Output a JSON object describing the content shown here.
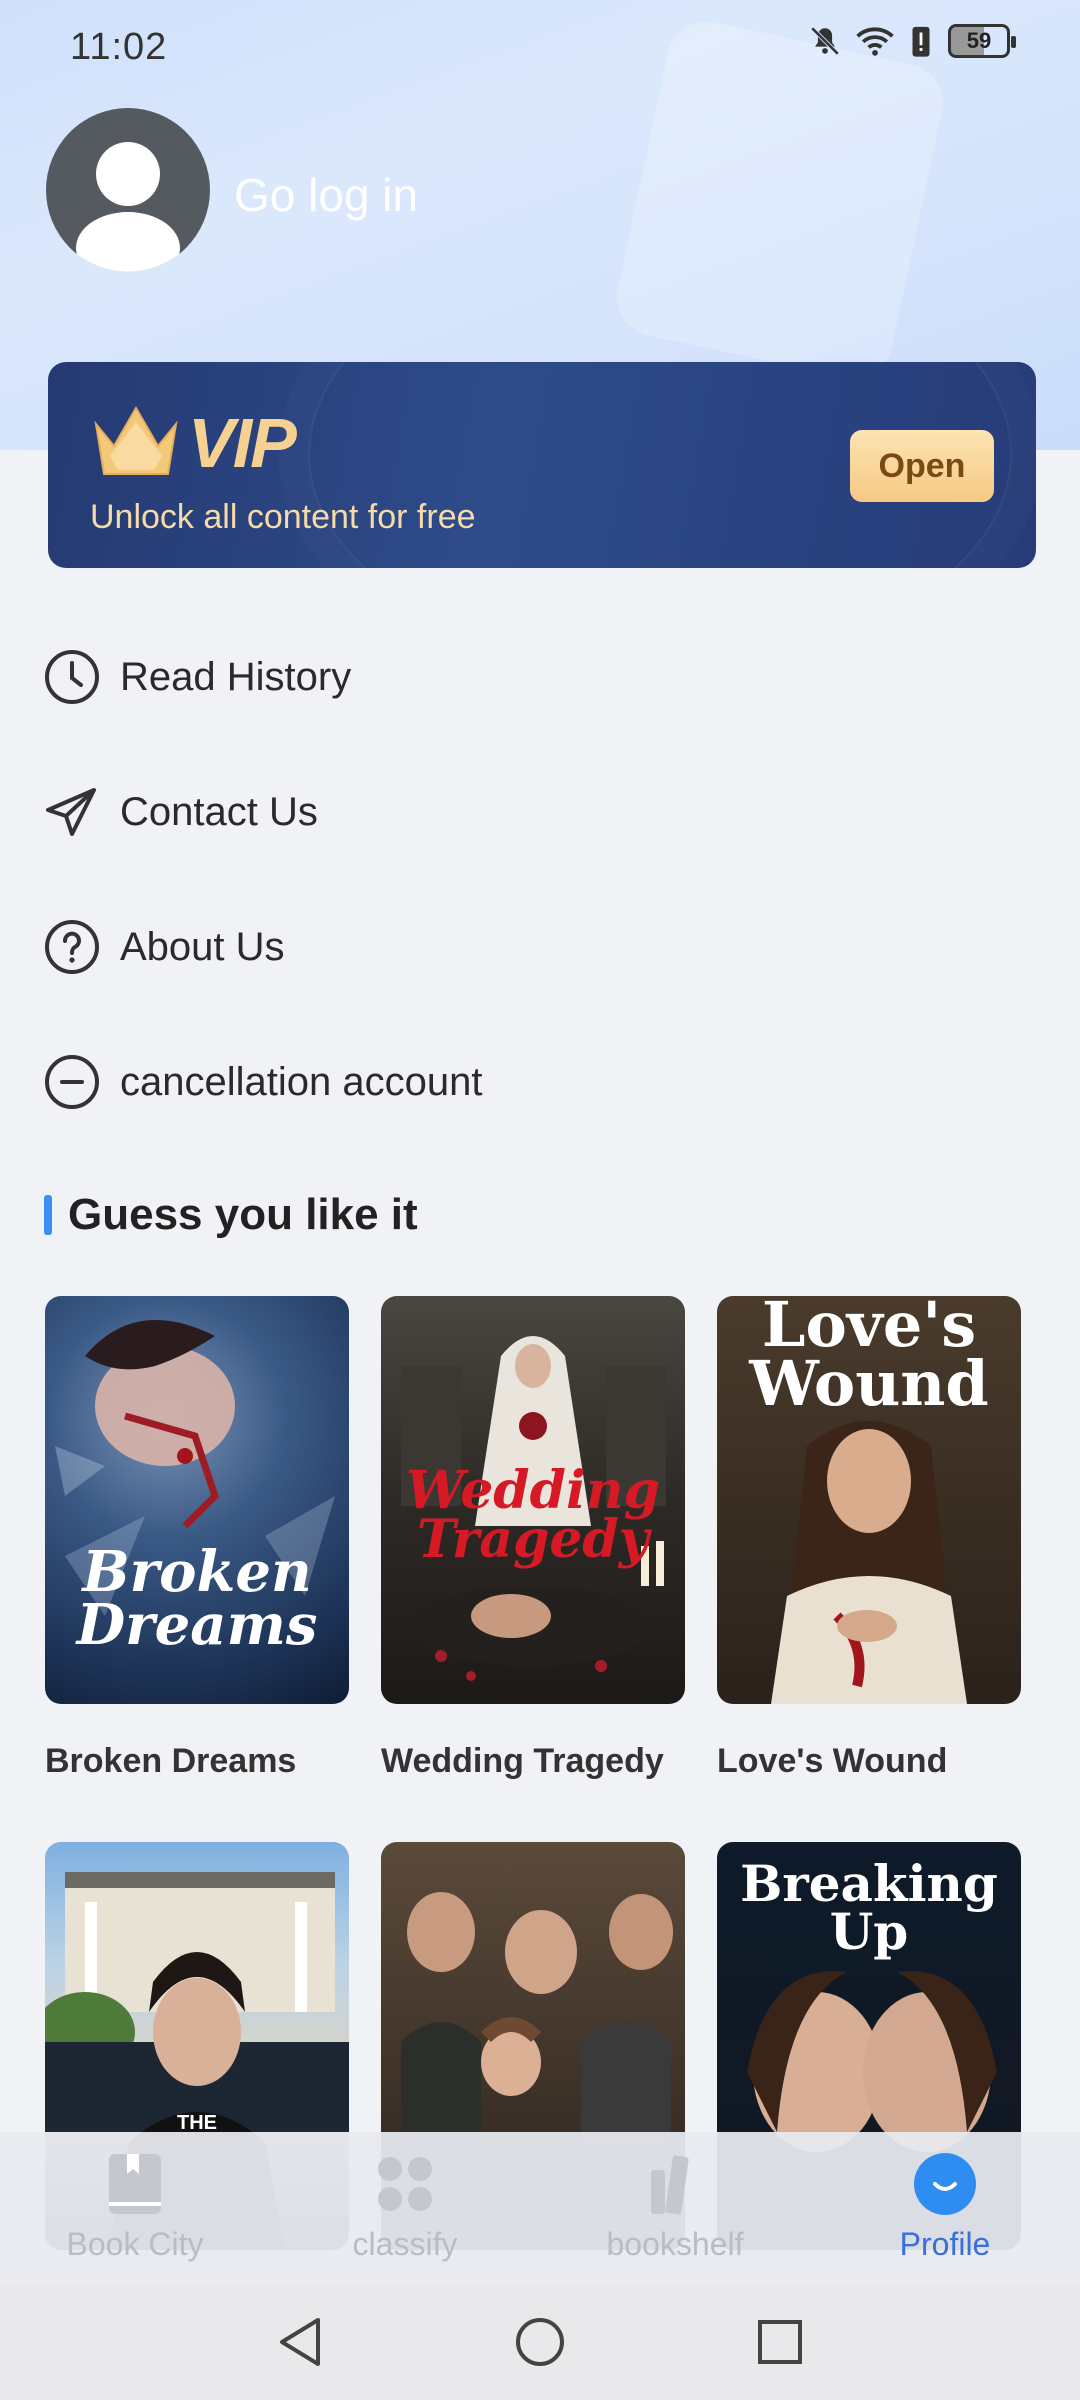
{
  "status_bar": {
    "time": "11:02",
    "battery": "59",
    "icons": [
      "bell-off-icon",
      "wifi-icon",
      "battery-alert-icon",
      "battery-icon"
    ]
  },
  "profile": {
    "login_label": "Go log in",
    "avatar_icon": "user-avatar-icon"
  },
  "vip": {
    "logo_text": "VIP",
    "subtitle": "Unlock all content for free",
    "button_label": "Open",
    "accent_color": "#f6d191"
  },
  "menu": {
    "items": [
      {
        "label": "Read History",
        "icon": "clock-icon"
      },
      {
        "label": "Contact Us",
        "icon": "send-icon"
      },
      {
        "label": "About Us",
        "icon": "help-circle-icon"
      },
      {
        "label": "cancellation account",
        "icon": "minus-circle-icon"
      }
    ]
  },
  "recommend": {
    "title": "Guess you like it",
    "books": [
      {
        "title": "Broken Dreams",
        "cover_text_1": "Broken",
        "cover_text_2": "Dreams"
      },
      {
        "title": "Wedding Tragedy",
        "cover_text_1": "Wedding",
        "cover_text_2": "Tragedy"
      },
      {
        "title": "Love's Wound",
        "cover_text_1": "Love's",
        "cover_text_2": "Wound"
      },
      {
        "cover_text_1": "THE"
      },
      {},
      {
        "cover_text_1": "Breaking",
        "cover_text_2": "Up"
      }
    ]
  },
  "bottom_nav": {
    "items": [
      {
        "label": "Book City",
        "icon": "book-icon",
        "active": false
      },
      {
        "label": "classify",
        "icon": "grid-icon",
        "active": false
      },
      {
        "label": "bookshelf",
        "icon": "bookshelf-icon",
        "active": false
      },
      {
        "label": "Profile",
        "icon": "smile-icon",
        "active": true
      }
    ],
    "active_color": "#3a6fd8"
  },
  "system_nav": [
    "back-icon",
    "home-icon",
    "recents-icon"
  ]
}
